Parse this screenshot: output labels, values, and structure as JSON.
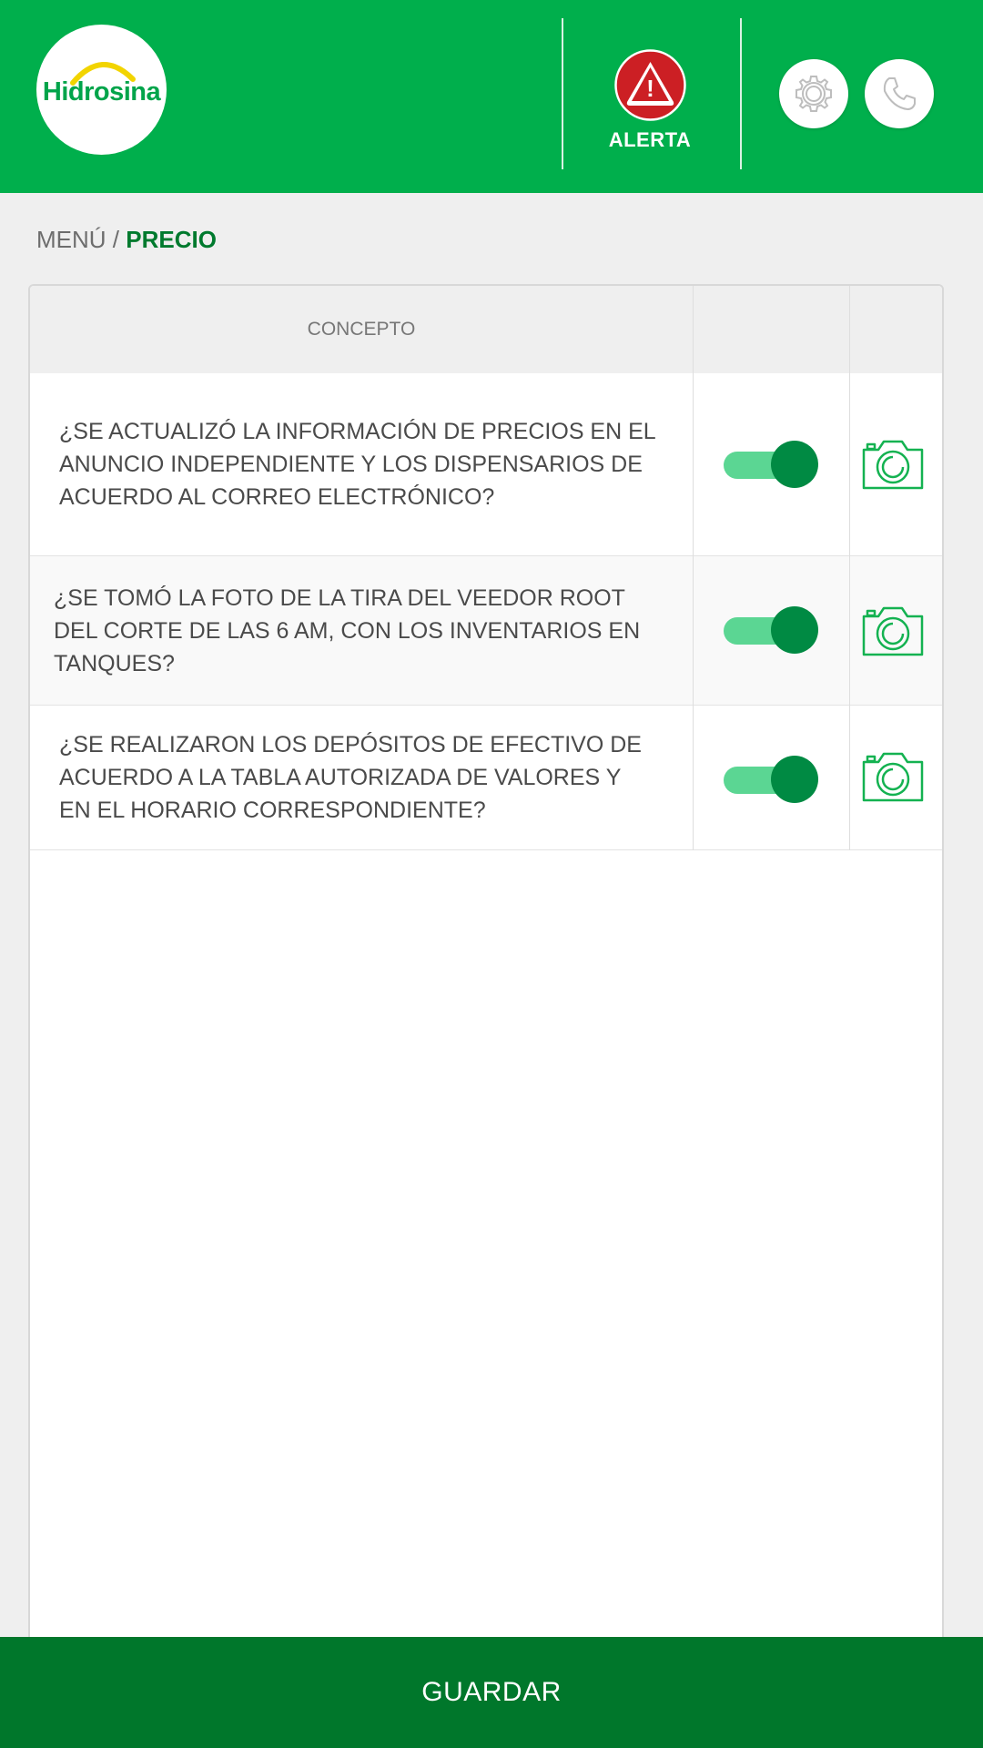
{
  "header": {
    "logo_text": "Hidrosina",
    "alert_label": "ALERTA",
    "alert_symbol": "!"
  },
  "icons": {
    "alert": "alert-icon",
    "settings": "gear-icon",
    "phone": "phone-icon",
    "camera": "camera-icon"
  },
  "breadcrumb": {
    "parent": "MENÚ",
    "separator": "/",
    "current": "PRECIO"
  },
  "table": {
    "headers": [
      "CONCEPTO",
      "",
      ""
    ],
    "rows": [
      {
        "question": " ¿SE ACTUALIZÓ LA INFORMACIÓN DE PRECIOS EN EL ANUNCIO INDEPENDIENTE Y LOS DISPENSARIOS DE ACUERDO AL CORREO ELECTRÓNICO?",
        "checked": true
      },
      {
        "question": "¿SE TOMÓ LA FOTO DE LA TIRA DEL VEEDOR ROOT DEL CORTE DE LAS 6 AM, CON LOS INVENTARIOS EN TANQUES?",
        "checked": true
      },
      {
        "question": "¿SE REALIZARON LOS DEPÓSITOS DE EFECTIVO DE ACUERDO A LA TABLA AUTORIZADA DE VALORES Y EN EL HORARIO CORRESPONDIENTE?",
        "checked": true
      }
    ]
  },
  "footer": {
    "save_label": "GUARDAR"
  },
  "colors": {
    "header_bg": "#00af4c",
    "footer_bg": "#00772b",
    "toggle_on": "#008a43",
    "toggle_track": "#5bd693",
    "alert_red": "#cc1f24",
    "breadcrumb_current": "#007a2e"
  }
}
